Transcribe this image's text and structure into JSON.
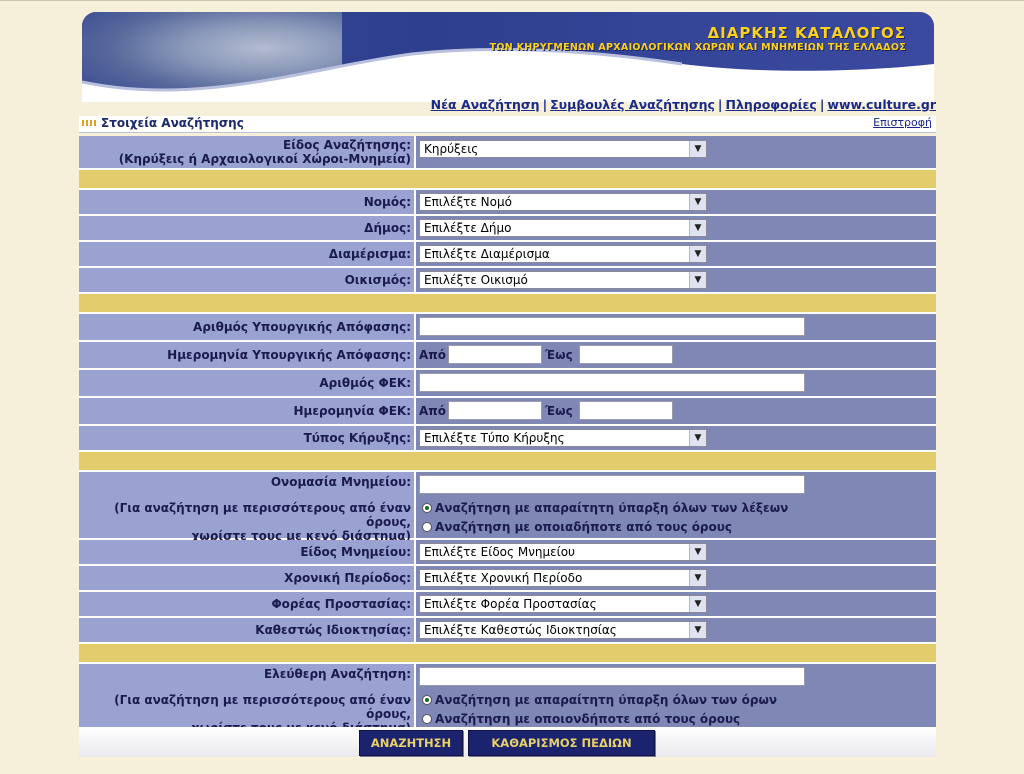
{
  "banner": {
    "title": "ΔΙΑΡΚΗΣ ΚΑΤΑΛΟΓΟΣ",
    "subtitle": "ΤΩΝ ΚΗΡΥΓΜΕΝΩΝ ΑΡΧΑΙΟΛΟΓΙΚΩΝ ΧΩΡΩΝ ΚΑΙ ΜΝΗΜΕΙΩΝ ΤΗΣ ΕΛΛΑΔΟΣ"
  },
  "nav": {
    "new_search": "Νέα Αναζήτηση",
    "search_tips": "Συμβουλές Αναζήτησης",
    "info": "Πληροφορίες",
    "site": "www.culture.gr",
    "separator": "|"
  },
  "section": {
    "title": "Στοιχεία Αναζήτησης",
    "back": "Επιστροφή"
  },
  "form": {
    "search_type": {
      "label": "Είδος Αναζήτησης:",
      "label2": "(Κηρύξεις ή Αρχαιολογικοί Χώροι-Μνημεία)",
      "value": "Κηρύξεις"
    },
    "prefecture": {
      "label": "Νομός:",
      "value": "Επιλέξτε Νομό"
    },
    "municipality": {
      "label": "Δήμος:",
      "value": "Επιλέξτε Δήμο"
    },
    "district": {
      "label": "Διαμέρισμα:",
      "value": "Επιλέξτε Διαμέρισμα"
    },
    "settlement": {
      "label": "Οικισμός:",
      "value": "Επιλέξτε Οικισμό"
    },
    "decision_number": {
      "label": "Αριθμός Υπουργικής Απόφασης:"
    },
    "decision_date": {
      "label": "Ημερομηνία Υπουργικής Απόφασης:",
      "from": "Από",
      "to": "Έως"
    },
    "fek_number": {
      "label": "Αριθμός ΦΕΚ:"
    },
    "fek_date": {
      "label": "Ημερομηνία ΦΕΚ:",
      "from": "Από",
      "to": "Έως"
    },
    "declaration_type": {
      "label": "Τύπος Κήρυξης:",
      "value": "Επιλέξτε Τύπο Κήρυξης"
    },
    "monument_name": {
      "label": "Ονομασία Μνημείου:",
      "hint1": "(Για αναζήτηση με περισσότερους από έναν όρους,",
      "hint2": "χωρίστε τους με κενό διάστημα)",
      "radio_all": "Αναζήτηση με απαραίτητη ύπαρξη όλων των λέξεων",
      "radio_any": "Αναζήτηση με οποιαδήποτε από τους όρους"
    },
    "monument_type": {
      "label": "Είδος Μνημείου:",
      "value": "Επιλέξτε Είδος Μνημείου"
    },
    "period": {
      "label": "Χρονική Περίοδος:",
      "value": "Επιλέξτε Χρονική Περίοδο"
    },
    "protection_body": {
      "label": "Φορέας Προστασίας:",
      "value": "Επιλέξτε Φορέα Προστασίας"
    },
    "ownership": {
      "label": "Καθεστώς Ιδιοκτησίας:",
      "value": "Επιλέξτε Καθεστώς Ιδιοκτησίας"
    },
    "free_search": {
      "label": "Ελεύθερη Αναζήτηση:",
      "hint1": "(Για αναζήτηση με περισσότερους από έναν όρους,",
      "hint2": "χωρίστε τους με κενό διάστημα)",
      "radio_all": "Αναζήτηση με απαραίτητη ύπαρξη όλων των όρων",
      "radio_any": "Αναζήτηση με οποιονδήποτε από τους όρους"
    }
  },
  "buttons": {
    "search": "ΑΝΑΖΗΤΗΣΗ",
    "clear": "ΚΑΘΑΡΙΣΜΟΣ ΠΕΔΙΩΝ"
  },
  "icons": {
    "dropdown": "chevron-down-icon",
    "section": "dotted-bullet-icon"
  },
  "colors": {
    "label_bg": "#9aa2d2",
    "value_bg": "#7f87b5",
    "separator": "#e3cc6c",
    "button_bg": "#1b236e",
    "button_text": "#e8d06a"
  }
}
